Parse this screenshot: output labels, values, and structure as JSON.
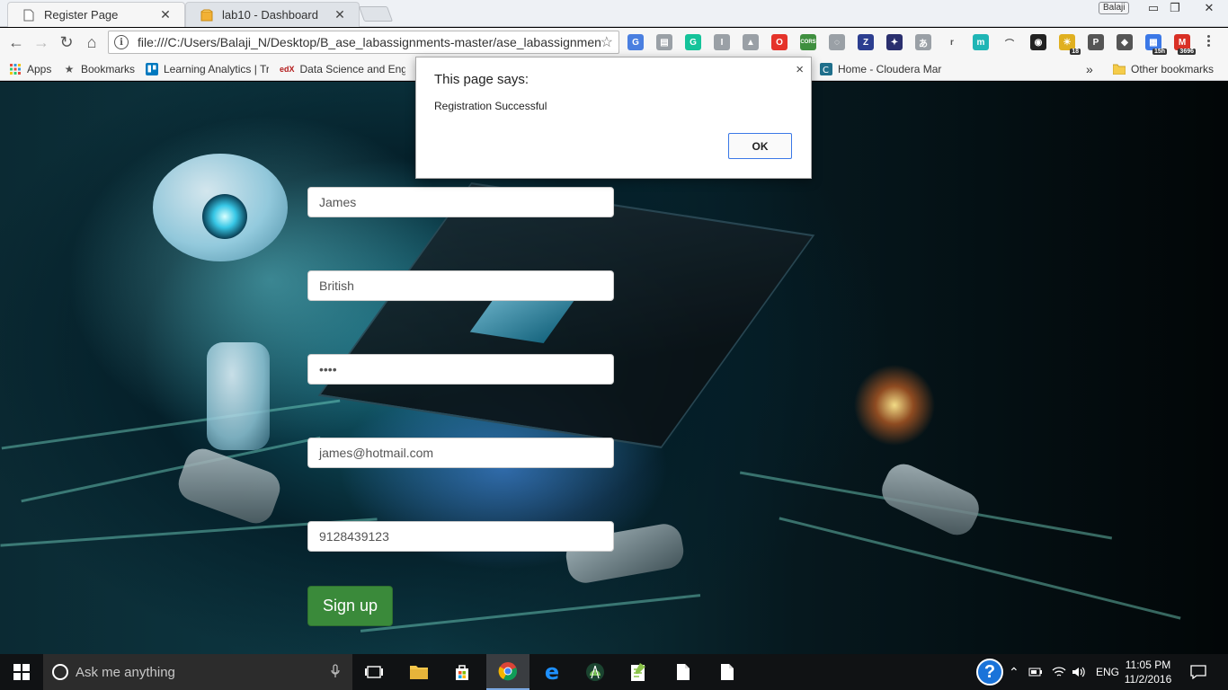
{
  "browser": {
    "tabs": [
      {
        "label": "Register Page",
        "active": true,
        "icon": "page-icon"
      },
      {
        "label": "lab10 - Dashboard",
        "active": false,
        "icon": "box-icon"
      }
    ],
    "user_badge": "Balaji",
    "url": "file:///C:/Users/Balaji_N/Desktop/B_ase_labassignments-master/ase_labassignments",
    "extensions": [
      {
        "name": "translate-icon",
        "glyph": "G",
        "color": "#4a7fe0"
      },
      {
        "name": "document-icon",
        "glyph": "▤",
        "color": "#9aa0a6"
      },
      {
        "name": "grammarly-icon",
        "glyph": "G",
        "color": "#15c39a"
      },
      {
        "name": "instapaper-icon",
        "glyph": "I",
        "color": "#9aa0a6"
      },
      {
        "name": "drive-icon",
        "glyph": "▲",
        "color": "#9aa0a6"
      },
      {
        "name": "opera-icon",
        "glyph": "O",
        "color": "#e5332a"
      },
      {
        "name": "cors-icon",
        "glyph": "CORS",
        "color": "#3f8f3f"
      },
      {
        "name": "ghost-icon",
        "glyph": "◌",
        "color": "#9aa0a6"
      },
      {
        "name": "zotero-icon",
        "glyph": "Z",
        "color": "#2c3e90"
      },
      {
        "name": "puzzle-icon",
        "glyph": "✦",
        "color": "#2a2f6e"
      },
      {
        "name": "translator-icon",
        "glyph": "あ",
        "color": "#9aa0a6"
      },
      {
        "name": "r-icon",
        "glyph": "r",
        "color": "#f6f6f6"
      },
      {
        "name": "mendeley-icon",
        "glyph": "m",
        "color": "#1fb5b5"
      },
      {
        "name": "rainbow-icon",
        "glyph": "⌒",
        "color": "#f6f6f6"
      },
      {
        "name": "color-wheel-icon",
        "glyph": "◉",
        "color": "#222"
      },
      {
        "name": "weather-icon",
        "glyph": "☀",
        "color": "#e0b020",
        "badge": "18"
      },
      {
        "name": "pocket-icon",
        "glyph": "P",
        "color": "#555"
      },
      {
        "name": "bulb-icon",
        "glyph": "◆",
        "color": "#555"
      },
      {
        "name": "calendar-icon",
        "glyph": "▦",
        "color": "#3b78e7",
        "badge": "15h"
      },
      {
        "name": "gmail-icon",
        "glyph": "M",
        "color": "#d93025",
        "badge": "3696"
      }
    ]
  },
  "bookmarks": {
    "apps": "Apps",
    "bookmarks": "Bookmarks",
    "learning": "Learning Analytics | Tr",
    "datascience": "Data Science and Eng",
    "cloudera": "Home - Cloudera Mar",
    "overflow": "»",
    "other": "Other bookmarks"
  },
  "dialog": {
    "title": "This page says:",
    "message": "Registration Successful",
    "ok_label": "OK",
    "close": "×"
  },
  "form": {
    "first_name": "James",
    "last_name": "British",
    "password": "••••",
    "email": "james@hotmail.com",
    "phone": "9128439123",
    "signup_label": "Sign up"
  },
  "taskbar": {
    "search_placeholder": "Ask me anything",
    "lang": "ENG",
    "time": "11:05 PM",
    "date": "11/2/2016"
  }
}
